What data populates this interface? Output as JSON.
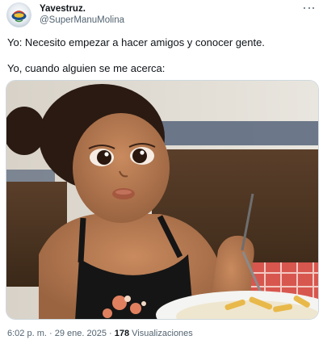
{
  "author": {
    "display_name": "Yavestruz.",
    "handle": "@SuperManuMolina"
  },
  "more_icon": "more-horizontal-icon",
  "tweet": {
    "line1": "Yo: Necesito empezar a hacer amigos y conocer gente.",
    "line2": "Yo, cuando alguien se me acerca:"
  },
  "meta": {
    "time": "6:02 p. m.",
    "separator1": "·",
    "date": "29 ene. 2025",
    "separator2": "·",
    "view_count": "178",
    "view_label": "Visualizaciones"
  },
  "colors": {
    "text_primary": "#0f1419",
    "text_secondary": "#536471",
    "border": "#cfd9de"
  }
}
